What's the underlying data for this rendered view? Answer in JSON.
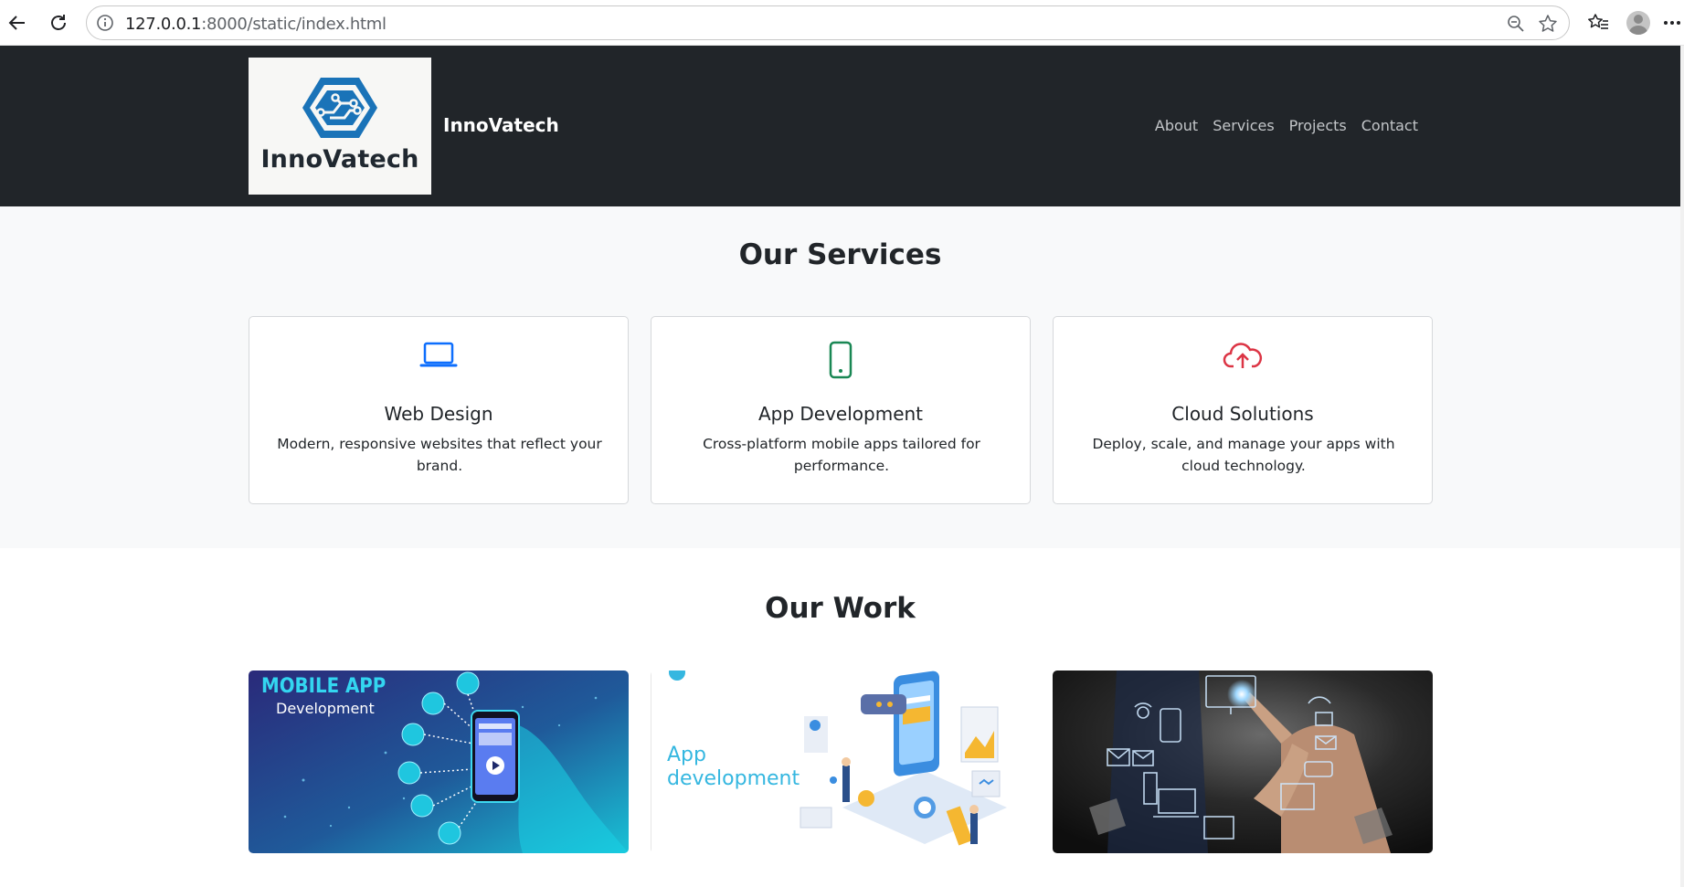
{
  "browser": {
    "url_host": "127.0.0.1",
    "url_rest": ":8000/static/index.html"
  },
  "header": {
    "logo_text": "InnoVatech",
    "brand_name": "InnoVatech",
    "nav": [
      "About",
      "Services",
      "Projects",
      "Contact"
    ]
  },
  "services": {
    "title": "Our Services",
    "cards": [
      {
        "title": "Web Design",
        "text": "Modern, responsive websites that reflect your brand.",
        "icon": "laptop-icon",
        "color": "#0d6efd"
      },
      {
        "title": "App Development",
        "text": "Cross-platform mobile apps tailored for performance.",
        "icon": "phone-icon",
        "color": "#198754"
      },
      {
        "title": "Cloud Solutions",
        "text": "Deploy, scale, and manage your apps with cloud technology.",
        "icon": "cloud-upload-icon",
        "color": "#dc3545"
      }
    ]
  },
  "work": {
    "title": "Our Work",
    "images": [
      {
        "heading": "MOBILE APP",
        "subheading": "Development"
      },
      {
        "heading": "App",
        "subheading": "development"
      },
      {
        "heading": "",
        "subheading": ""
      }
    ]
  },
  "colors": {
    "header_bg": "#212529",
    "section_bg": "#f8f9fa",
    "logo_blue": "#1a73b8"
  }
}
